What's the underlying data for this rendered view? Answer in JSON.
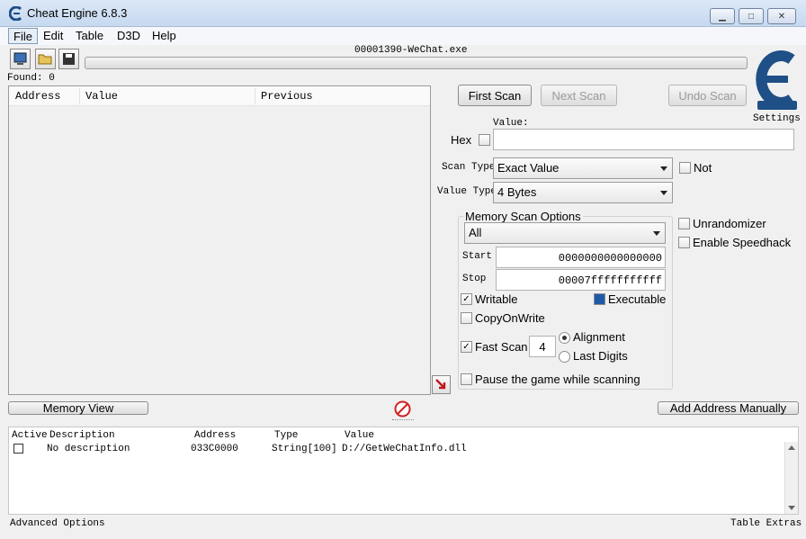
{
  "window": {
    "title": "Cheat Engine 6.8.3"
  },
  "menu": [
    "File",
    "Edit",
    "Table",
    "D3D",
    "Help"
  ],
  "process_name": "00001390-WeChat.exe",
  "found_label": "Found: 0",
  "results_columns": [
    "Address",
    "Value",
    "Previous"
  ],
  "scan": {
    "first_scan": "First Scan",
    "next_scan": "Next Scan",
    "undo_scan": "Undo Scan",
    "settings": "Settings",
    "value_label": "Value:",
    "hex_label": "Hex",
    "scan_type_label": "Scan Type",
    "scan_type_value": "Exact Value",
    "value_type_label": "Value Type",
    "value_type_value": "4 Bytes",
    "not_label": "Not"
  },
  "memory_options": {
    "title": "Memory Scan Options",
    "region": "All",
    "start_label": "Start",
    "start_value": "0000000000000000",
    "stop_label": "Stop",
    "stop_value": "00007fffffffffff",
    "writable": "Writable",
    "executable": "Executable",
    "copyonwrite": "CopyOnWrite",
    "fast_scan": "Fast Scan",
    "fast_scan_value": "4",
    "alignment": "Alignment",
    "last_digits": "Last Digits",
    "pause": "Pause the game while scanning"
  },
  "extra_options": {
    "unrandomizer": "Unrandomizer",
    "speedhack": "Enable Speedhack"
  },
  "memory_view_button": "Memory View",
  "add_address_button": "Add Address Manually",
  "address_list": {
    "columns": [
      "Active",
      "Description",
      "Address",
      "Type",
      "Value"
    ],
    "rows": [
      {
        "description": "No description",
        "address": "033C0000",
        "type": "String[100]",
        "value": "D://GetWeChatInfo.dll"
      }
    ]
  },
  "status_left": "Advanced Options",
  "status_right": "Table Extras",
  "colors": {
    "accent": "#1e4f86",
    "title_bg": "#c6d9f0"
  }
}
